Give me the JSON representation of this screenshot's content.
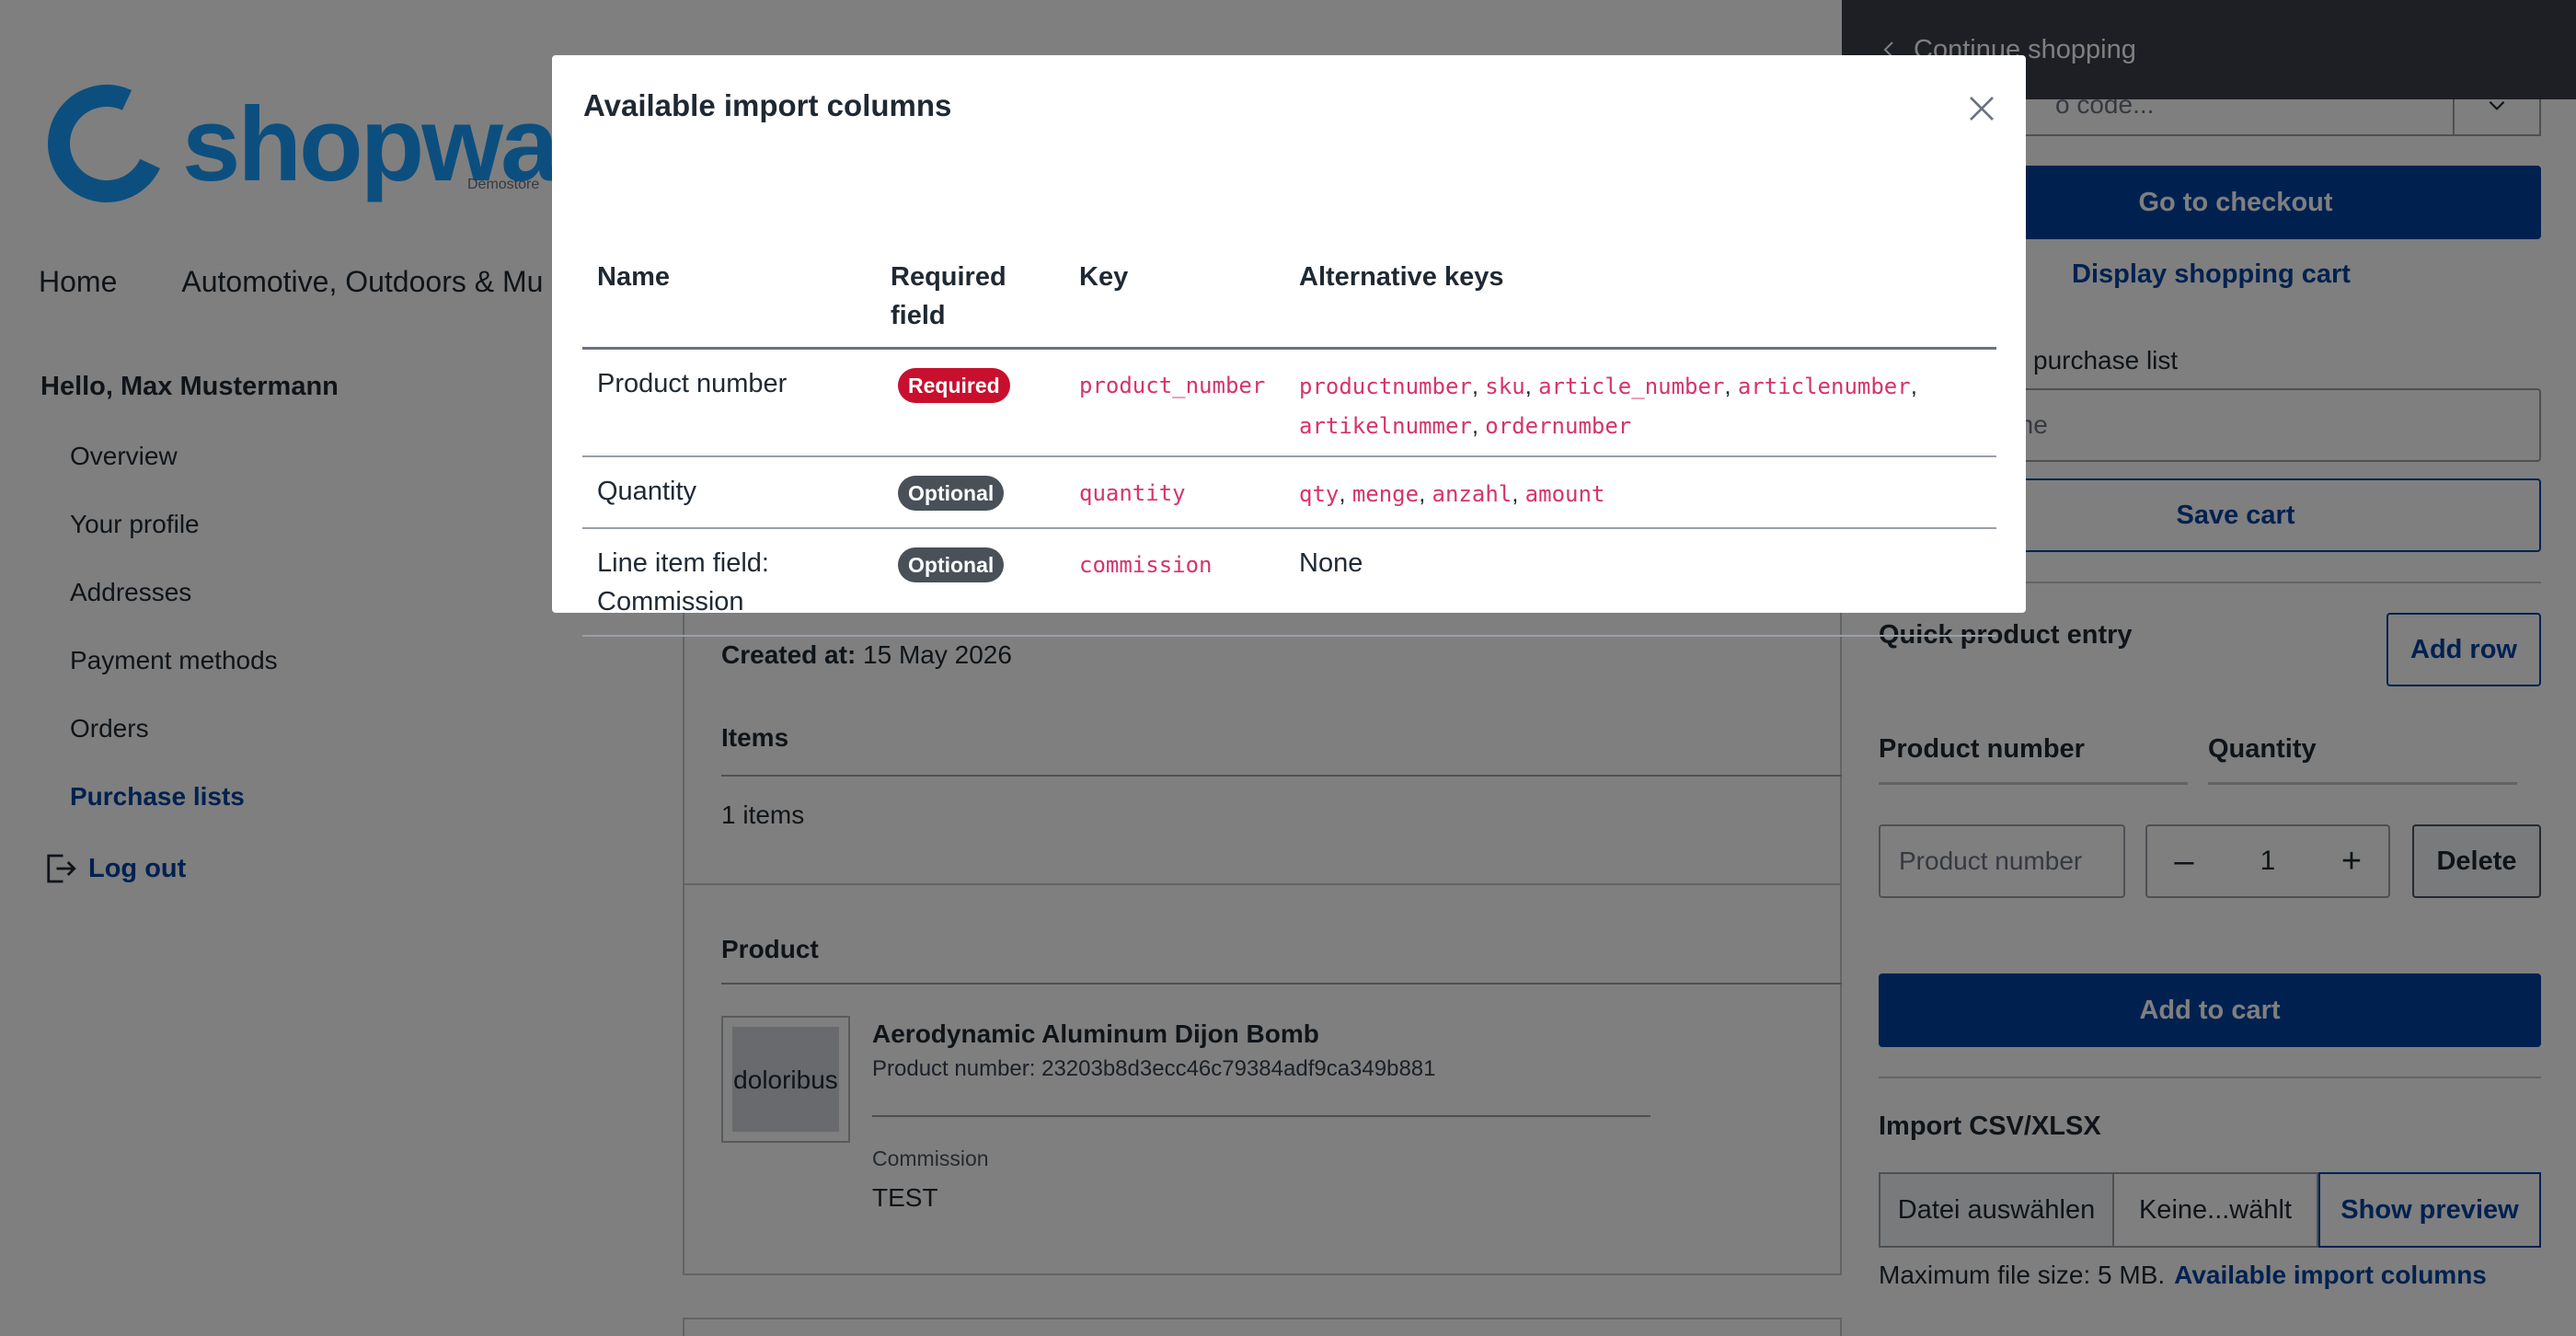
{
  "logo": {
    "text": "shopware",
    "sub": "Demostore"
  },
  "main_nav": [
    "Home",
    "Automotive, Outdoors & Mu"
  ],
  "account": {
    "greeting": "Hello, Max Mustermann",
    "links": [
      "Overview",
      "Your profile",
      "Addresses",
      "Payment methods",
      "Orders",
      "Purchase lists"
    ],
    "active": "Purchase lists",
    "logout": "Log out"
  },
  "purchase_list": {
    "created_label": "Created at:",
    "created_value": "15 May 2026",
    "items_heading": "Items",
    "items_count": "1 items",
    "product_heading": "Product",
    "thumb_text": "doloribus",
    "product_name": "Aerodynamic Aluminum Dijon Bomb",
    "product_number": "Product number: 23203b8d3ecc46c79384adf9ca349b881",
    "commission_label": "Commission",
    "commission_value": "TEST"
  },
  "offcanvas": {
    "header": "Continue shopping",
    "promo_placeholder": "o code...",
    "checkout": "Go to checkout",
    "display_cart": "Display shopping cart",
    "purchase_list_label": "purchase list",
    "list_name_placeholder": "ist name",
    "save_cart": "Save cart",
    "quick_entry_title": "Quick product entry",
    "add_row": "Add row",
    "col_product": "Product number",
    "col_quantity": "Quantity",
    "product_placeholder": "Product number",
    "quantity": "1",
    "delete": "Delete",
    "add_to_cart": "Add to cart",
    "import_title": "Import CSV/XLSX",
    "choose_file": "Datei auswählen",
    "no_file": "Keine...wählt",
    "show_preview": "Show preview",
    "max_file": "Maximum file size: 5 MB.",
    "available_columns": "Available import columns"
  },
  "modal": {
    "title": "Available import columns",
    "headers": {
      "name": "Name",
      "required_1": "Required",
      "required_2": "field",
      "key": "Key",
      "alt": "Alternative keys"
    },
    "rows": [
      {
        "name": "Product number",
        "badge": "Required",
        "key": "product_number",
        "alt": [
          "productnumber",
          "sku",
          "article_number",
          "articlenumber",
          "artikelnummer",
          "ordernumber"
        ]
      },
      {
        "name": "Quantity",
        "badge": "Optional",
        "key": "quantity",
        "alt": [
          "qty",
          "menge",
          "anzahl",
          "amount"
        ]
      },
      {
        "name_1": "Line item field:",
        "name_2": "Commission",
        "badge": "Optional",
        "key": "commission",
        "alt_text": "None"
      }
    ]
  },
  "colors": {
    "brand": "#189eff",
    "primary": "#0042a0",
    "required_badge": "#c8102e",
    "optional_badge": "#495057",
    "code": "#d6336c"
  }
}
